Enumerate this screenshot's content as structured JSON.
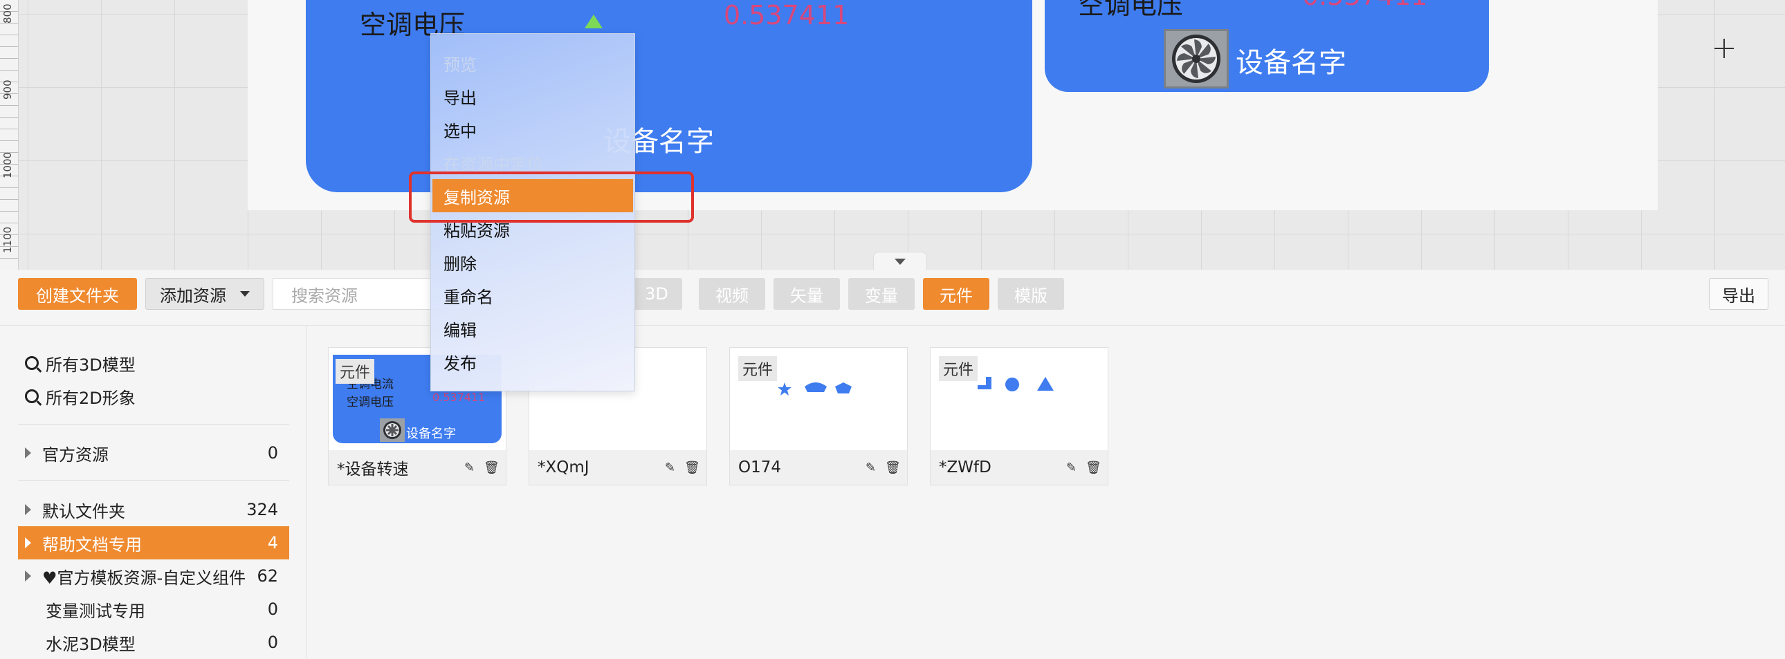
{
  "ruler": {
    "ticks": [
      "800",
      "900",
      "1000",
      "1100"
    ]
  },
  "canvas": {
    "card_left": {
      "voltage_label": "空调电压",
      "voltage_value": "0.537411",
      "device_name": "设备名字"
    },
    "card_right": {
      "voltage_label": "空调电压",
      "voltage_value": "0.537411",
      "device_name": "设备名字"
    }
  },
  "context_menu": {
    "items": [
      {
        "label": "预览",
        "state": "disabled"
      },
      {
        "label": "导出",
        "state": "normal"
      },
      {
        "label": "选中",
        "state": "normal"
      },
      {
        "label": "在资源中定位",
        "state": "disabled"
      },
      {
        "label": "复制资源",
        "state": "highlighted"
      },
      {
        "label": "粘贴资源",
        "state": "normal"
      },
      {
        "label": "删除",
        "state": "normal"
      },
      {
        "label": "重命名",
        "state": "normal"
      },
      {
        "label": "编辑",
        "state": "normal"
      },
      {
        "label": "发布",
        "state": "normal"
      }
    ]
  },
  "toolbar": {
    "create_folder": "创建文件夹",
    "add_resource": "添加资源",
    "search_placeholder": "搜索资源",
    "filters": [
      "3D",
      "视频",
      "矢量",
      "变量",
      "元件",
      "模版"
    ],
    "active_filter": "元件",
    "export": "导出"
  },
  "sidebar": {
    "search_items": [
      "所有3D模型",
      "所有2D形象"
    ],
    "official": {
      "label": "官方资源",
      "count": "0"
    },
    "folders": [
      {
        "label": "默认文件夹",
        "count": "324",
        "expandable": true,
        "active": false
      },
      {
        "label": "帮助文档专用",
        "count": "4",
        "expandable": true,
        "active": true
      },
      {
        "label": "♥官方模板资源-自定义组件",
        "count": "62",
        "expandable": true,
        "active": false
      },
      {
        "label": "变量测试专用",
        "count": "0",
        "expandable": false,
        "active": false
      },
      {
        "label": "水泥3D模型",
        "count": "0",
        "expandable": false,
        "active": false
      }
    ]
  },
  "assets": [
    {
      "name": "*设备转速",
      "tag": "元件",
      "thumb": {
        "current_label": "空调电流",
        "voltage_label": "空调电压",
        "voltage_value": "0.537411",
        "device_name": "设备名字"
      }
    },
    {
      "name": "*XQmJ",
      "tag": ""
    },
    {
      "name": "O174",
      "tag": "元件"
    },
    {
      "name": "*ZWfD",
      "tag": "元件"
    }
  ],
  "colors": {
    "accent": "#ef8a2f",
    "card_blue": "#3e7cf0",
    "value_red": "#d9487c",
    "highlight_red": "#e0322d"
  }
}
